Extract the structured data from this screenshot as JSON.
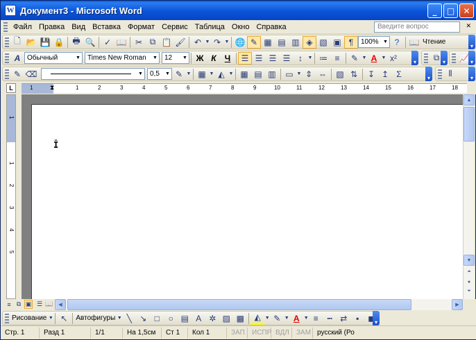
{
  "window": {
    "title": "Документ3 - Microsoft Word",
    "app_icon": "W",
    "buttons": {
      "minimize": "_",
      "maximize": "□",
      "close": "✕"
    }
  },
  "menu": {
    "items": [
      "Файл",
      "Правка",
      "Вид",
      "Вставка",
      "Формат",
      "Сервис",
      "Таблица",
      "Окно",
      "Справка"
    ],
    "help_placeholder": "Введите вопрос"
  },
  "standard_toolbar": {
    "zoom": "100%",
    "reading_label": "Чтение"
  },
  "formatting_toolbar": {
    "style": "Обычный",
    "font": "Times New Roman",
    "size": "12",
    "bold": "Ж",
    "italic": "К",
    "underline": "Ч"
  },
  "tables_toolbar": {
    "line_weight": "0,5"
  },
  "ruler": {
    "corner": "L",
    "numbers": [
      "1",
      "1",
      "2",
      "3",
      "4",
      "5",
      "6",
      "7",
      "8",
      "9",
      "10",
      "11",
      "12",
      "13",
      "14",
      "15",
      "16",
      "17",
      "18"
    ],
    "vertical_numbers": [
      "1",
      "1",
      "2",
      "3",
      "4",
      "5"
    ]
  },
  "drawing_toolbar": {
    "drawing_label": "Рисование",
    "autoshapes_label": "Автофигуры"
  },
  "status": {
    "page": "Стр. 1",
    "section": "Разд 1",
    "pages": "1/1",
    "at": "На 1,5см",
    "line": "Ст 1",
    "col": "Кол 1",
    "rec": "ЗАП",
    "trk": "ИСПР",
    "ext": "ВДЛ",
    "ovr": "ЗАМ",
    "language": "русский (Ро"
  },
  "colors": {
    "titlebar": "#0a5ad8",
    "toolbar_bg": "#ece9d8",
    "font_color": "#e00000",
    "highlight": "#ffff00"
  }
}
